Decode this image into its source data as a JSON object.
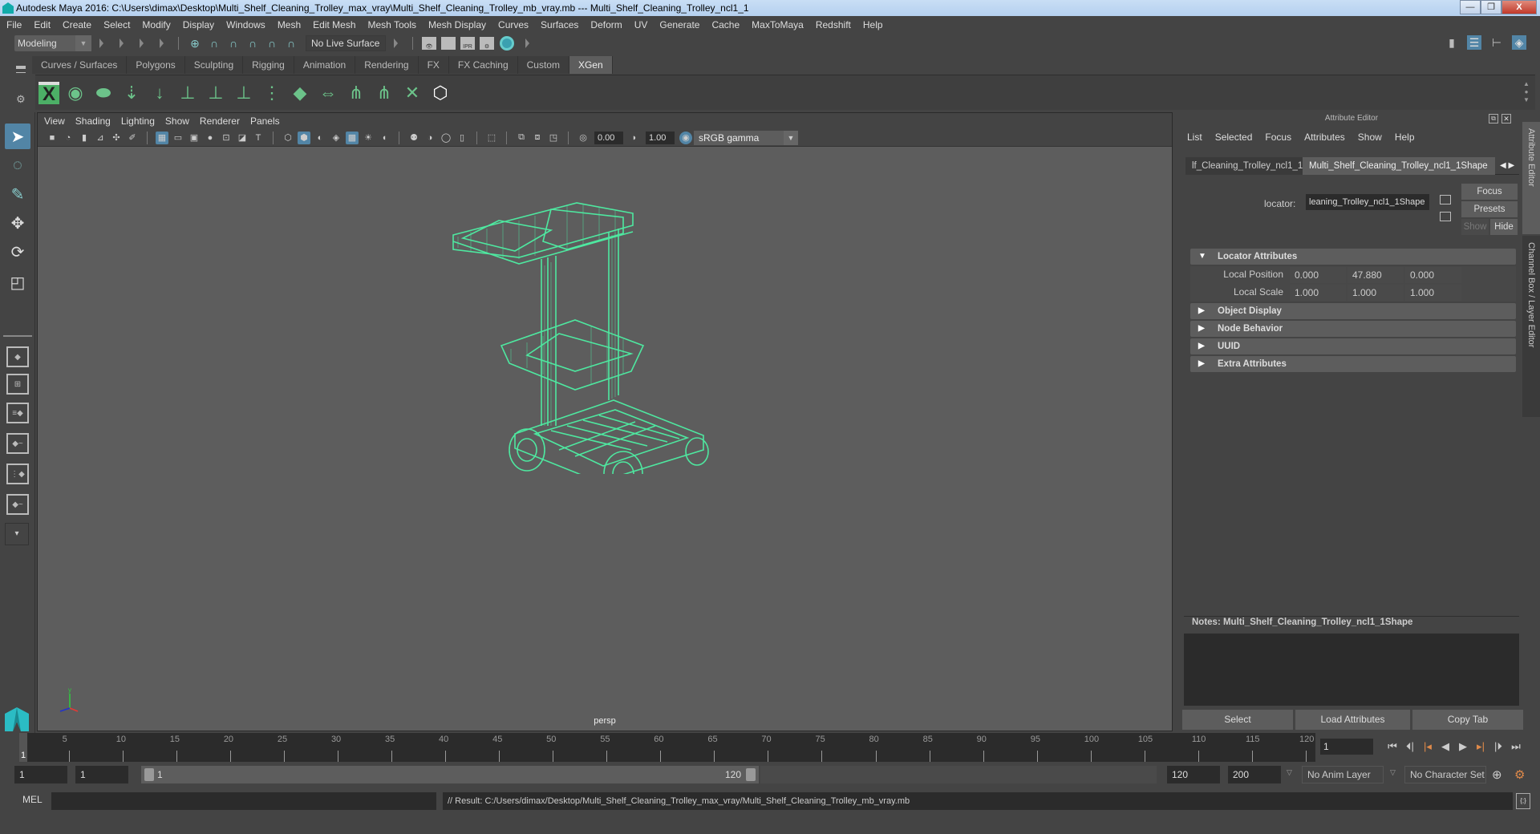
{
  "window": {
    "title": "Autodesk Maya 2016: C:\\Users\\dimax\\Desktop\\Multi_Shelf_Cleaning_Trolley_max_vray\\Multi_Shelf_Cleaning_Trolley_mb_vray.mb   ---   Multi_Shelf_Cleaning_Trolley_ncl1_1",
    "minimize": "—",
    "maximize": "❐",
    "close": "X"
  },
  "menubar": [
    "File",
    "Edit",
    "Create",
    "Select",
    "Modify",
    "Display",
    "Windows",
    "Mesh",
    "Edit Mesh",
    "Mesh Tools",
    "Mesh Display",
    "Curves",
    "Surfaces",
    "Deform",
    "UV",
    "Generate",
    "Cache",
    "MaxToMaya",
    "Redshift",
    "Help"
  ],
  "statusline": {
    "mode": "Modeling",
    "live_surface": "No Live Surface",
    "snap_icons": [
      "snap-grid-icon",
      "snap-curve-icon",
      "snap-point-icon",
      "snap-view-plane-icon",
      "snap-live-icon",
      "make-live-icon"
    ],
    "render_icons": [
      {
        "name": "render-view-icon",
        "glyph": "👁"
      },
      {
        "name": "render-current-icon",
        "glyph": ""
      },
      {
        "name": "ipr-render-icon",
        "glyph": "IPR"
      },
      {
        "name": "render-settings-icon",
        "glyph": "⚙"
      }
    ]
  },
  "shelf": {
    "tabs": [
      "Curves / Surfaces",
      "Polygons",
      "Sculpting",
      "Rigging",
      "Animation",
      "Rendering",
      "FX",
      "FX Caching",
      "Custom",
      "XGen"
    ],
    "active_tab": "XGen",
    "icons": [
      {
        "name": "xgen-editor-icon",
        "glyph": "X"
      },
      {
        "name": "xgen-preview-icon",
        "glyph": "◉"
      },
      {
        "name": "xgen-clear-preview-icon",
        "glyph": "⬬"
      },
      {
        "name": "xgen-add-guides-icon",
        "glyph": "⇣"
      },
      {
        "name": "xgen-place-guide-icon",
        "glyph": "↓"
      },
      {
        "name": "xgen-add-guide-icon",
        "glyph": "⊥"
      },
      {
        "name": "xgen-select-guide-icon",
        "glyph": "⊥"
      },
      {
        "name": "xgen-lock-guide-icon",
        "glyph": "⊥"
      },
      {
        "name": "xgen-guide-curve-icon",
        "glyph": "⋮"
      },
      {
        "name": "xgen-region-map-icon",
        "glyph": "◆"
      },
      {
        "name": "xgen-flip-icon",
        "glyph": "⇔"
      },
      {
        "name": "xgen-sculpt-icon",
        "glyph": "⋔"
      },
      {
        "name": "xgen-bound-icon",
        "glyph": "⋔"
      },
      {
        "name": "xgen-delete-guide-icon",
        "glyph": "✕"
      },
      {
        "name": "xgen-interactive-groom-icon",
        "glyph": "⬡"
      }
    ]
  },
  "viewport": {
    "menu": [
      "View",
      "Shading",
      "Lighting",
      "Show",
      "Renderer",
      "Panels"
    ],
    "exposure": "0.00",
    "gamma": "1.00",
    "color_space": "sRGB gamma",
    "camera_label": "persp",
    "wire_color": "#4ee8a0",
    "bg_color": "#5d5d5d"
  },
  "attribute_editor": {
    "title": "Attribute Editor",
    "menu": [
      "List",
      "Selected",
      "Focus",
      "Attributes",
      "Show",
      "Help"
    ],
    "tabs": [
      "lf_Cleaning_Trolley_ncl1_1",
      "Multi_Shelf_Cleaning_Trolley_ncl1_1Shape"
    ],
    "active_tab": 1,
    "node_type_label": "locator:",
    "node_name": "leaning_Trolley_ncl1_1Shape",
    "buttons": {
      "focus": "Focus",
      "presets": "Presets",
      "show": "Show",
      "hide": "Hide"
    },
    "sections": [
      {
        "label": "Locator Attributes",
        "expanded": true
      },
      {
        "label": "Object Display",
        "expanded": false
      },
      {
        "label": "Node Behavior",
        "expanded": false
      },
      {
        "label": "UUID",
        "expanded": false
      },
      {
        "label": "Extra Attributes",
        "expanded": false
      }
    ],
    "local_position": {
      "label": "Local Position",
      "x": "0.000",
      "y": "47.880",
      "z": "0.000"
    },
    "local_scale": {
      "label": "Local Scale",
      "x": "1.000",
      "y": "1.000",
      "z": "1.000"
    },
    "notes_label": "Notes:  Multi_Shelf_Cleaning_Trolley_ncl1_1Shape",
    "notes_text": "",
    "bottom_buttons": [
      "Select",
      "Load Attributes",
      "Copy Tab"
    ]
  },
  "side_tabs": [
    "Attribute Editor",
    "Channel Box / Layer Editor"
  ],
  "timeline": {
    "start": 1,
    "end": 120,
    "current_frame": "1",
    "tick_labels": [
      "5",
      "10",
      "15",
      "20",
      "25",
      "30",
      "35",
      "40",
      "45",
      "50",
      "55",
      "60",
      "65",
      "70",
      "75",
      "80",
      "85",
      "90",
      "95",
      "100",
      "105",
      "110",
      "115",
      "120"
    ],
    "playhead_label": "1"
  },
  "range": {
    "start_field": "1",
    "anim_start_field": "1",
    "range_start": "1",
    "range_end": "120",
    "end_field": "120",
    "anim_end_field": "200",
    "anim_layer": "No Anim Layer",
    "character_set": "No Character Set"
  },
  "playback_buttons": [
    {
      "name": "go-to-start-button",
      "glyph": "⏮"
    },
    {
      "name": "step-back-key-button",
      "glyph": "⏴|"
    },
    {
      "name": "step-back-frame-button",
      "glyph": "|◂"
    },
    {
      "name": "play-backward-button",
      "glyph": "◀"
    },
    {
      "name": "play-forward-button",
      "glyph": "▶"
    },
    {
      "name": "step-forward-frame-button",
      "glyph": "▸|"
    },
    {
      "name": "step-forward-key-button",
      "glyph": "|⏵"
    },
    {
      "name": "go-to-end-button",
      "glyph": "⏭"
    }
  ],
  "commandline": {
    "lang": "MEL",
    "input": "",
    "result": "// Result: C:/Users/dimax/Desktop/Multi_Shelf_Cleaning_Trolley_max_vray/Multi_Shelf_Cleaning_Trolley_mb_vray.mb"
  }
}
